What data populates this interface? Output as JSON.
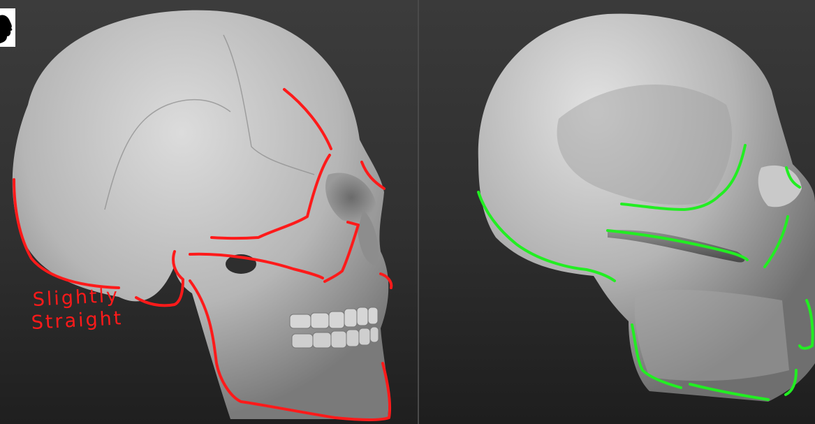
{
  "annotations": {
    "line1": "Slightly",
    "line2": "Straight"
  },
  "icons": {
    "corner": "head-silhouette-icon"
  },
  "colors": {
    "left_marks": "#ff1a1a",
    "right_marks": "#22ee22",
    "skull": "#b9b9b9"
  }
}
